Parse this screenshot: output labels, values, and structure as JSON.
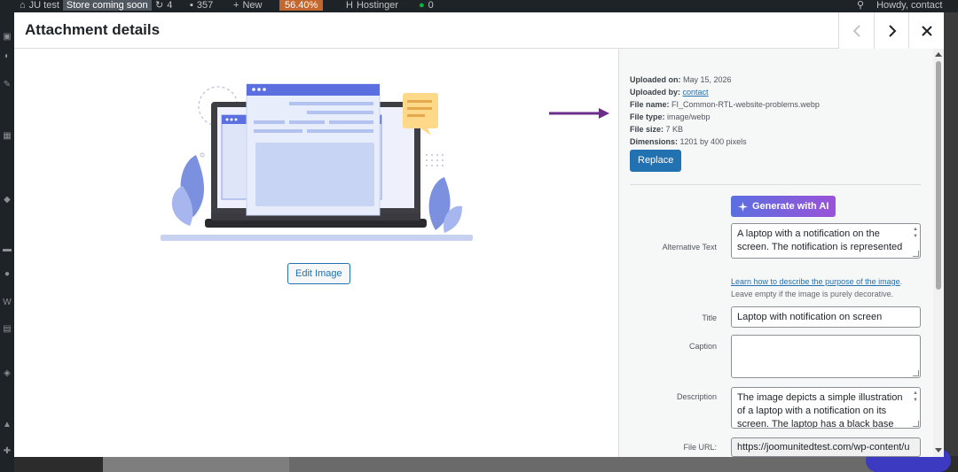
{
  "admin_bar": {
    "site_name": "JU test",
    "store_badge": "Store coming soon",
    "updates_count": "4",
    "comments_count": "357",
    "new_label": "New",
    "performance": "56.40%",
    "hosting": "Hostinger",
    "status_count": "0",
    "greeting": "Howdy, contact"
  },
  "modal": {
    "title": "Attachment details",
    "prev_icon": "chevron-left-icon",
    "next_icon": "chevron-right-icon",
    "close_icon": "close-icon"
  },
  "preview": {
    "edit_image_label": "Edit Image"
  },
  "details": {
    "uploaded_on_label": "Uploaded on:",
    "uploaded_on_value": "May 15, 2026",
    "uploaded_by_label": "Uploaded by:",
    "uploaded_by_value": "contact",
    "file_name_label": "File name:",
    "file_name_value": "FI_Common-RTL-website-problems.webp",
    "file_type_label": "File type:",
    "file_type_value": "image/webp",
    "file_size_label": "File size:",
    "file_size_value": "7 KB",
    "dimensions_label": "Dimensions:",
    "dimensions_value": "1201 by 400 pixels",
    "replace_label": "Replace"
  },
  "form": {
    "generate_ai_label": "Generate with AI",
    "alt_label": "Alternative Text",
    "alt_value": "A laptop with a notification on the screen. The notification is represented",
    "alt_help_link": "Learn how to describe the purpose of the image",
    "alt_help_after": ".",
    "alt_help_note": "Leave empty if the image is purely decorative.",
    "title_label": "Title",
    "title_value": "Laptop with notification on screen",
    "caption_label": "Caption",
    "caption_value": "",
    "description_label": "Description",
    "description_value": "The image depicts a simple illustration of a laptop with a notification on its screen. The laptop has a black base",
    "file_url_label": "File URL:",
    "file_url_value": "https://joomunitedtest.com/wp-content/u"
  },
  "colors": {
    "accent": "#2271b1",
    "arrow": "#6b2c8a",
    "ai_gradient_start": "#5b6fe0",
    "ai_gradient_end": "#9a53d8"
  }
}
